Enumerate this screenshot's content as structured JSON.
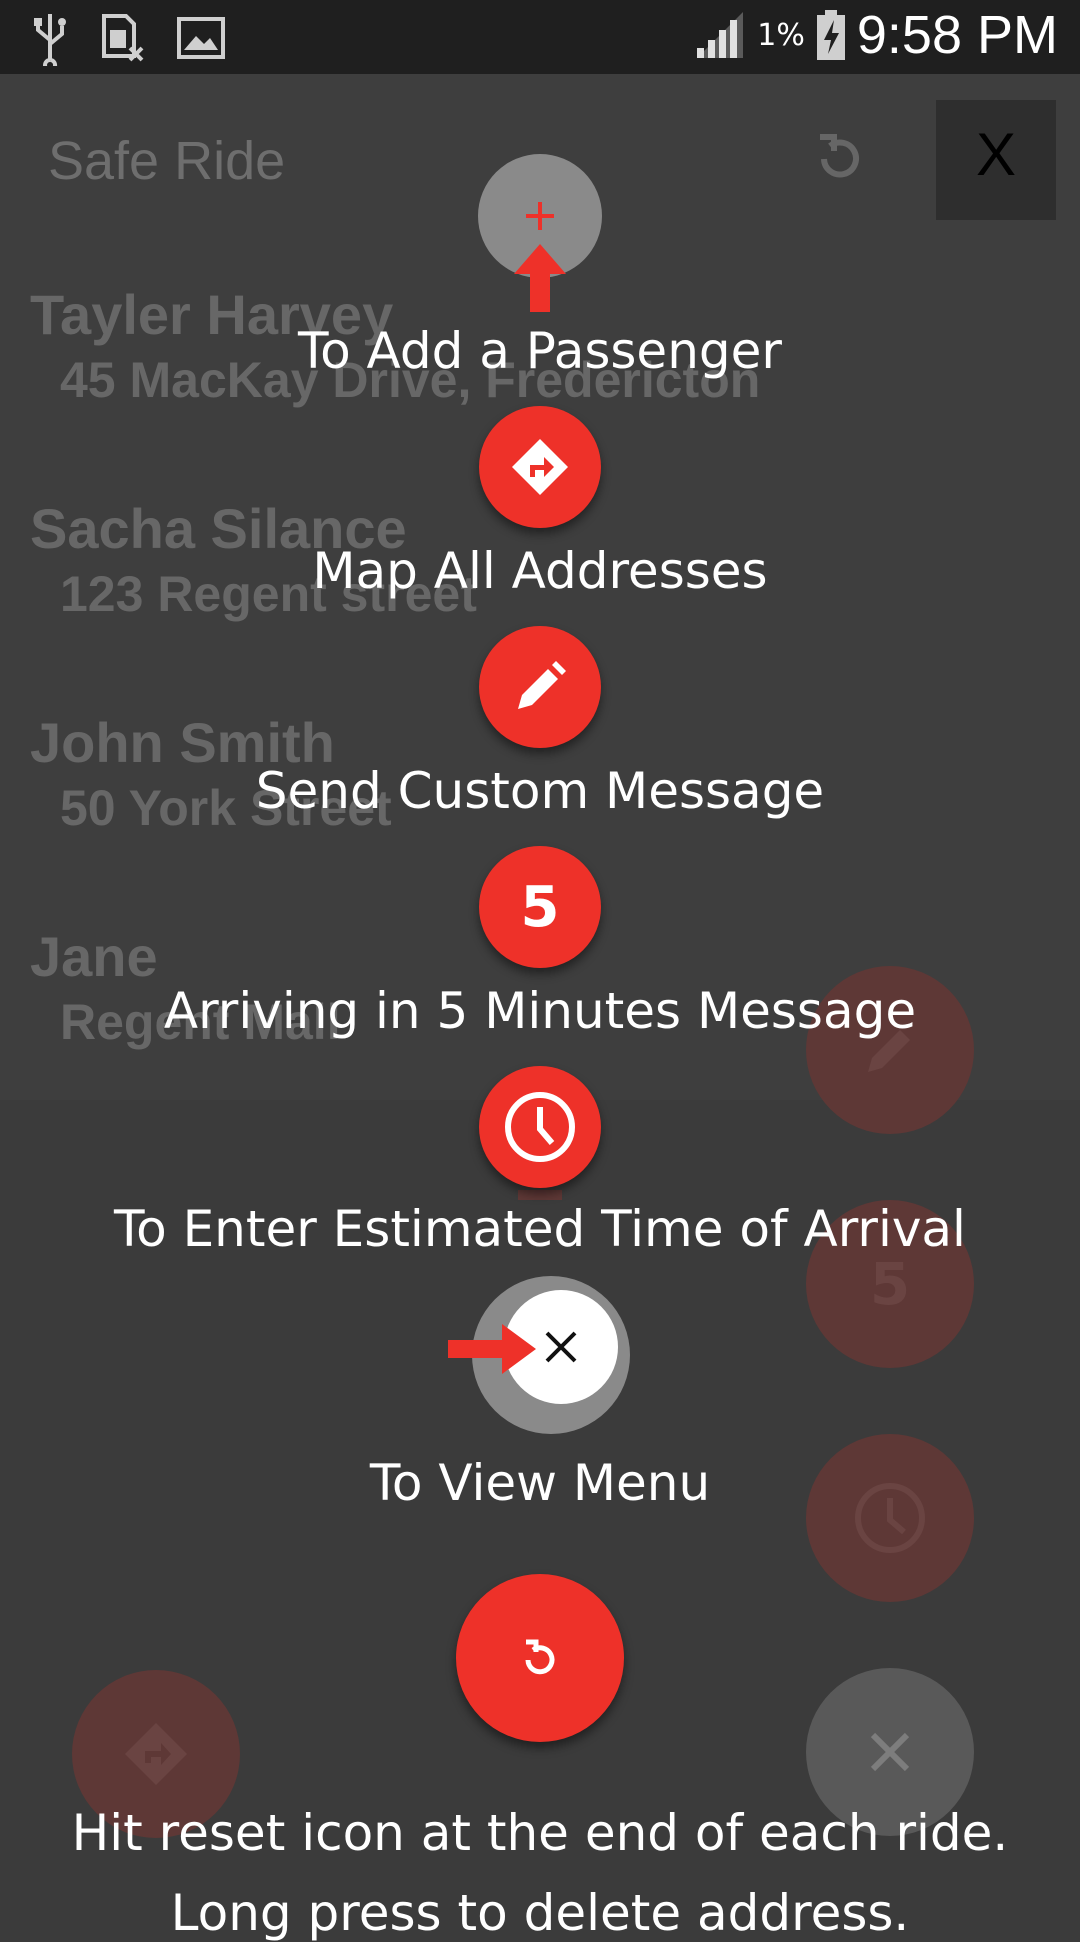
{
  "status_bar": {
    "battery_percent": "1%",
    "time": "9:58 PM",
    "icons": [
      "usb-icon",
      "sim-icon",
      "image-icon",
      "signal-icon",
      "battery-charging-icon"
    ]
  },
  "app": {
    "title": "Safe Ride",
    "help_label": "X",
    "passengers": [
      {
        "name": "Tayler Harvey",
        "address": "45 MacKay Drive, Fredericton"
      },
      {
        "name": "Sacha Silance",
        "address": "123 Regent street"
      },
      {
        "name": "John Smith",
        "address": "50 York Street"
      },
      {
        "name": "Jane",
        "address": "Regent Mall"
      }
    ],
    "five_label": "5"
  },
  "tutorial": {
    "add_passenger": "To Add a Passenger",
    "map_all": "Map All Addresses",
    "custom_message": "Send Custom Message",
    "five_label": "5",
    "arriving_five": "Arriving in 5 Minutes Message",
    "enter_eta": "To Enter Estimated Time of Arrival",
    "view_menu": "To View Menu",
    "reset_line1": "Hit reset icon at the end of each ride.",
    "reset_line2": "Long press to delete address."
  },
  "colors": {
    "accent": "#ee3129",
    "background": "#3b3b3b"
  }
}
